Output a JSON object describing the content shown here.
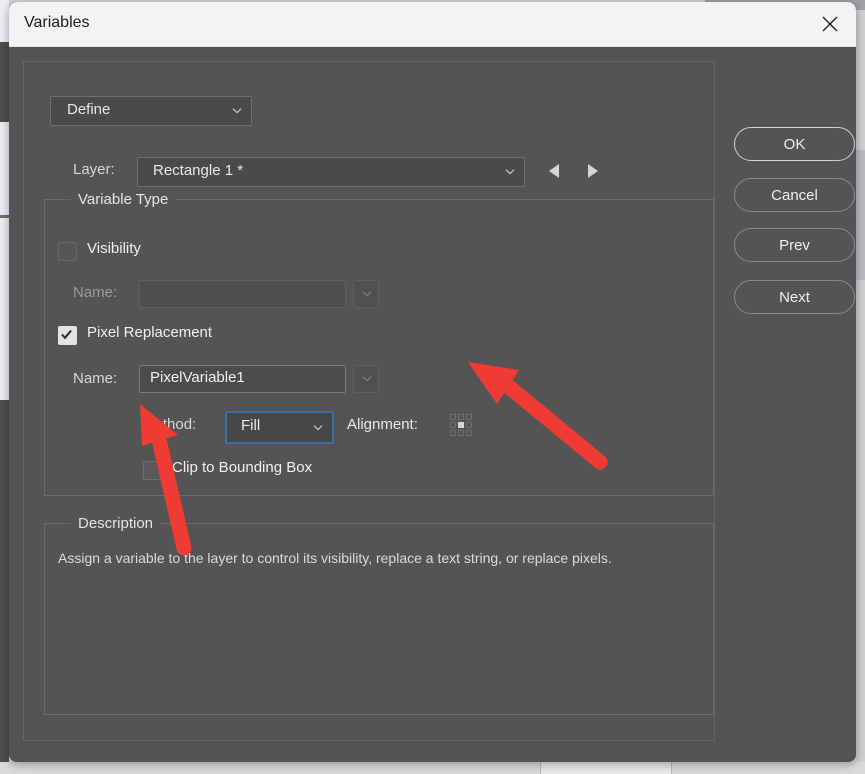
{
  "window": {
    "title": "Variables",
    "close_icon": "close-icon"
  },
  "toolbar": {
    "mode_select": "Define",
    "mode_chevron_icon": "chevron-down-icon"
  },
  "layer_row": {
    "label": "Layer:",
    "value": "Rectangle 1 *",
    "chevron_icon": "chevron-down-icon",
    "prev_icon": "triangle-left-icon",
    "next_icon": "triangle-right-icon"
  },
  "variable_type": {
    "group_title": "Variable Type",
    "visibility": {
      "label": "Visibility",
      "checked": false,
      "name_label": "Name:",
      "name_value": "",
      "name_placeholder": "",
      "dropdown_icon": "chevron-down-icon"
    },
    "pixel_replacement": {
      "label": "Pixel Replacement",
      "checked": true,
      "check_icon": "checkmark-icon",
      "name_label": "Name:",
      "name_value": "PixelVariable1",
      "dropdown_icon": "chevron-down-icon",
      "method_label": "Method:",
      "method_value": "Fill",
      "method_chevron_icon": "chevron-down-icon",
      "alignment_label": "Alignment:",
      "alignment_selected_index": 4,
      "alignment_cells": 9,
      "clip_label": "Clip to Bounding Box",
      "clip_checked": false
    }
  },
  "description": {
    "group_title": "Description",
    "text": "Assign a variable to the layer to control its visibility, replace a text string, or replace pixels."
  },
  "buttons": {
    "ok": "OK",
    "cancel": "Cancel",
    "prev": "Prev",
    "next": "Next"
  },
  "annotations": {
    "arrow_1": "red-arrow-pointing-to-alignment",
    "arrow_2": "red-arrow-pointing-to-clip-checkbox",
    "arrow_color": "#ef3b33"
  },
  "colors": {
    "dialog_background": "#545454",
    "titlebar_background": "#f3f3f4",
    "focus_border": "#3b6ea8",
    "accent_red": "#ef3b33"
  }
}
